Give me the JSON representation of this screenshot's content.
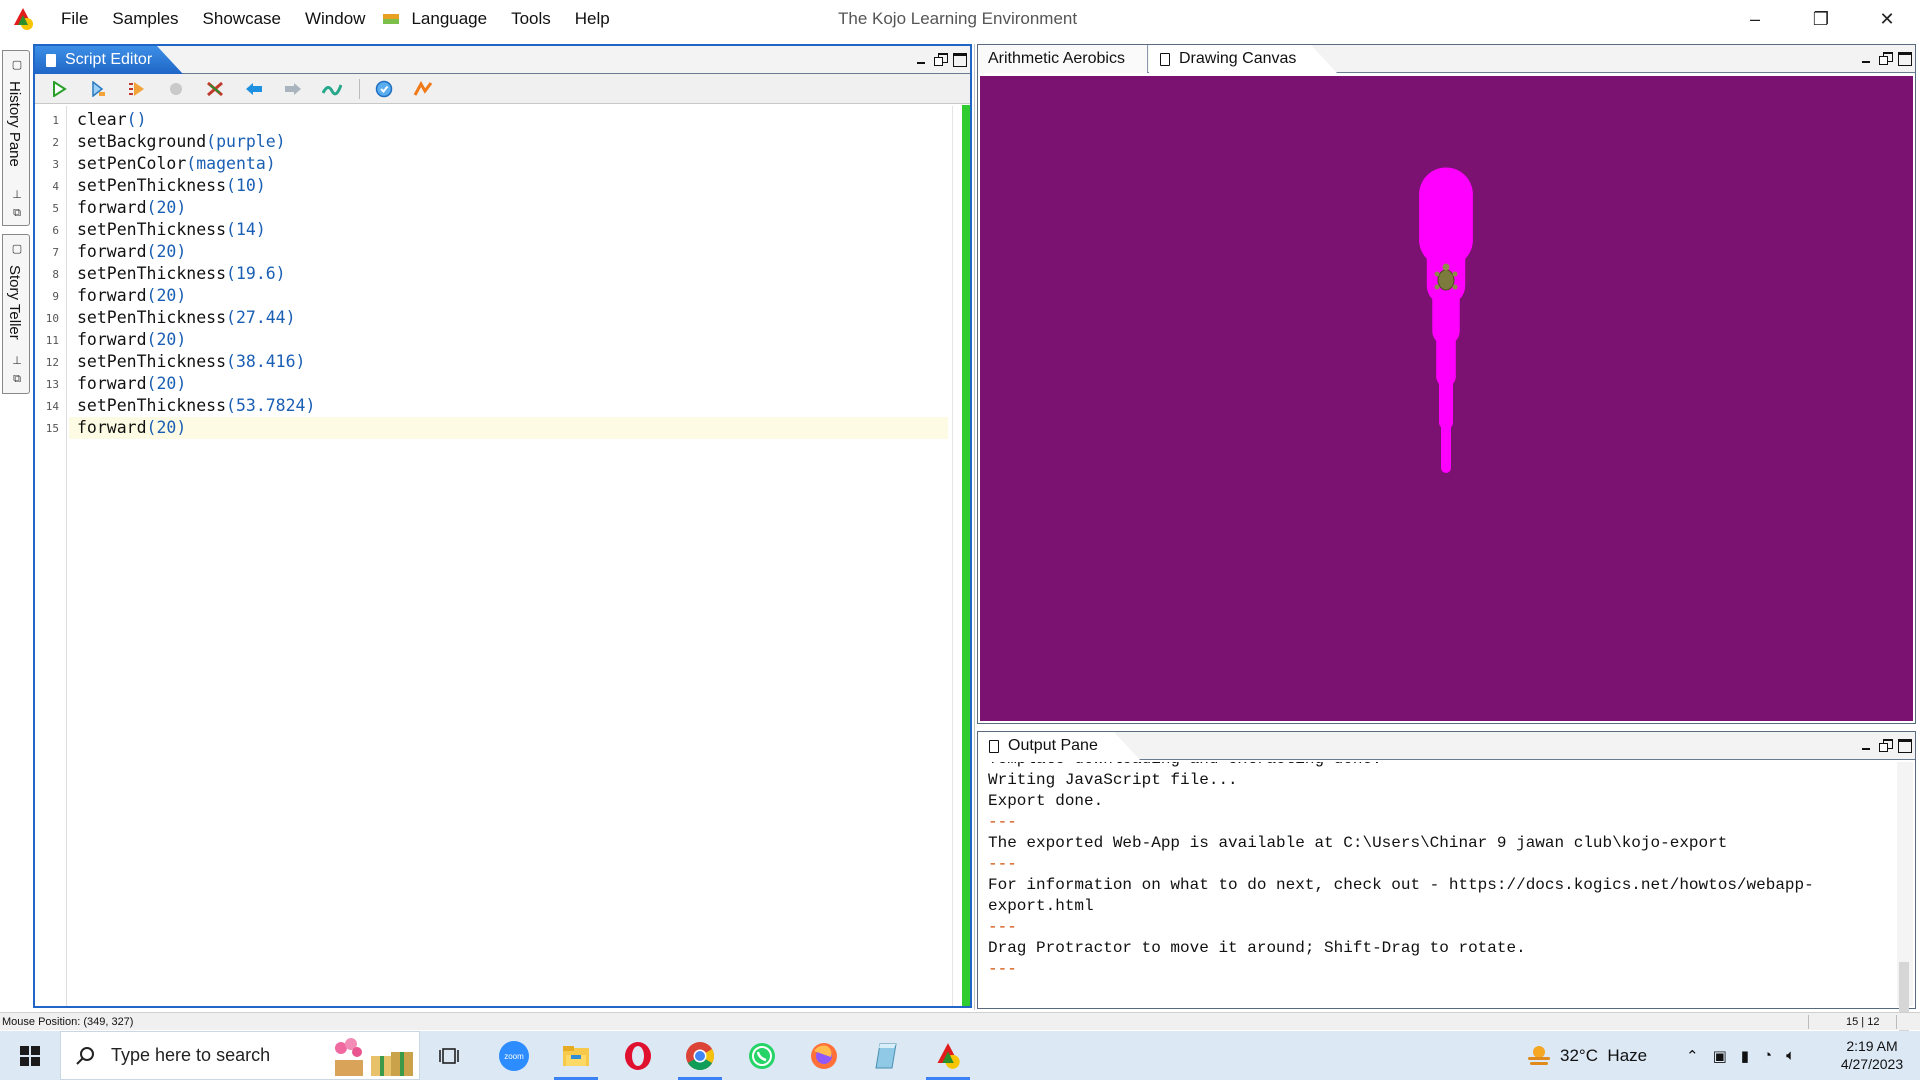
{
  "window": {
    "title": "The Kojo Learning Environment",
    "controls": {
      "minimize": "–",
      "restore": "❐",
      "close": "✕"
    }
  },
  "menu": [
    "File",
    "Samples",
    "Showcase",
    "Window",
    "Language",
    "Tools",
    "Help"
  ],
  "side_tabs": [
    "History Pane",
    "Story Teller"
  ],
  "editor": {
    "tab": "Script Editor",
    "toolbar_icons": [
      "run-icon",
      "run-worksheet-icon",
      "trace-icon",
      "stop-icon",
      "clear-icon",
      "history-back-icon",
      "history-forward-icon",
      "format-icon",
      "check-icon",
      "kojo-icon"
    ],
    "lines": [
      {
        "n": "1",
        "fn": "clear",
        "args": "()"
      },
      {
        "n": "2",
        "fn": "setBackground",
        "args": "(purple)"
      },
      {
        "n": "3",
        "fn": "setPenColor",
        "args": "(magenta)"
      },
      {
        "n": "4",
        "fn": "setPenThickness",
        "args": "(10)"
      },
      {
        "n": "5",
        "fn": "forward",
        "args": "(20)"
      },
      {
        "n": "6",
        "fn": "setPenThickness",
        "args": "(14)"
      },
      {
        "n": "7",
        "fn": "forward",
        "args": "(20)"
      },
      {
        "n": "8",
        "fn": "setPenThickness",
        "args": "(19.6)"
      },
      {
        "n": "9",
        "fn": "forward",
        "args": "(20)"
      },
      {
        "n": "10",
        "fn": "setPenThickness",
        "args": "(27.44)"
      },
      {
        "n": "11",
        "fn": "forward",
        "args": "(20)"
      },
      {
        "n": "12",
        "fn": "setPenThickness",
        "args": "(38.416)"
      },
      {
        "n": "13",
        "fn": "forward",
        "args": "(20)"
      },
      {
        "n": "14",
        "fn": "setPenThickness",
        "args": "(53.7824)"
      },
      {
        "n": "15",
        "fn": "forward",
        "args": "(20)"
      }
    ]
  },
  "canvas": {
    "tabs": [
      "Arithmetic Aerobics",
      "Drawing Canvas"
    ],
    "background": "#7b1170",
    "pen_color": "#ff00ff"
  },
  "output": {
    "tab": "Output Pane",
    "lines": [
      "Template downloading and extracting done.",
      "Writing JavaScript file...",
      "Export done.",
      "---",
      "The exported Web-App is available at C:\\Users\\Chinar 9 jawan club\\kojo-export",
      "---",
      "For information on what to do next, check out - https://docs.kogics.net/howtos/webapp-export.html",
      "---",
      "Drag Protractor to move it around; Shift-Drag to rotate.",
      "---"
    ]
  },
  "status": {
    "mouse_position": "Mouse Position: (349, 327)",
    "caret": "15 | 12"
  },
  "taskbar": {
    "search_placeholder": "Type here to search",
    "apps": [
      "task-view-icon",
      "zoom-icon",
      "file-explorer-icon",
      "opera-icon",
      "chrome-icon",
      "whatsapp-icon",
      "firefox-icon",
      "notes-icon",
      "kojo-icon"
    ],
    "weather": "32°C  Haze",
    "time": "2:19 AM",
    "date": "4/27/2023"
  }
}
